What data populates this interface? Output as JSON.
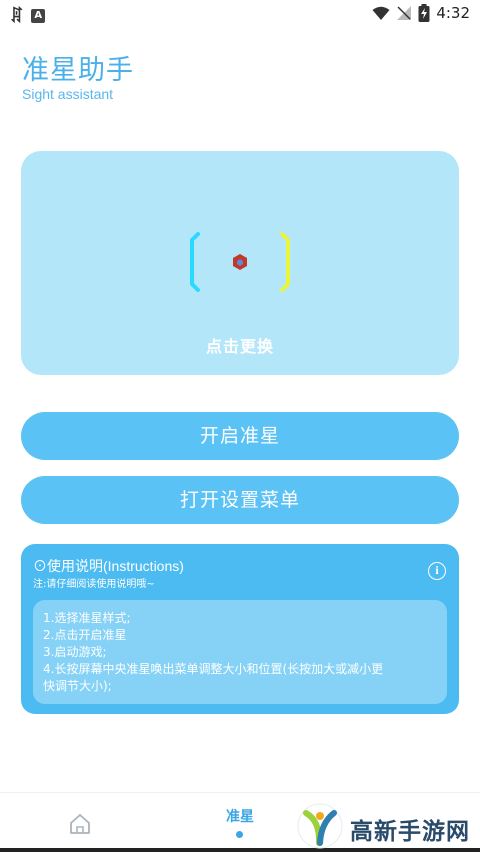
{
  "status_bar": {
    "time": "4:32",
    "left_icons": [
      "bug-icon",
      "a-notification-icon"
    ],
    "right_icons": [
      "wifi-icon",
      "signal-off-icon",
      "battery-charging-icon"
    ]
  },
  "header": {
    "title": "准星助手",
    "subtitle": "Sight assistant"
  },
  "preview": {
    "label": "点击更换"
  },
  "buttons": {
    "start": "开启准星",
    "menu": "打开设置菜单"
  },
  "instructions": {
    "title": "⊙使用说明(Instructions)",
    "note": "注:请仔细阅读使用说明哦~",
    "info_icon": "i",
    "lines": [
      "1.选择准星样式;",
      "2.点击开启准星",
      "3.启动游戏;",
      "4.长按屏幕中央准星唤出菜单调整大小和位置(长按加大或减小更",
      "快调节大小);"
    ]
  },
  "bottom_nav": {
    "tab_label": "准星"
  },
  "watermark": {
    "text": "高新手游网"
  },
  "colors": {
    "accent": "#4ab0ea",
    "button": "#5bc2f5",
    "preview_bg": "#b4e6fa",
    "instructions_bg": "#4cbbf2",
    "bracket_left": "#29d9ff",
    "bracket_right": "#e8f53a",
    "center_dot": "#c0392b"
  }
}
